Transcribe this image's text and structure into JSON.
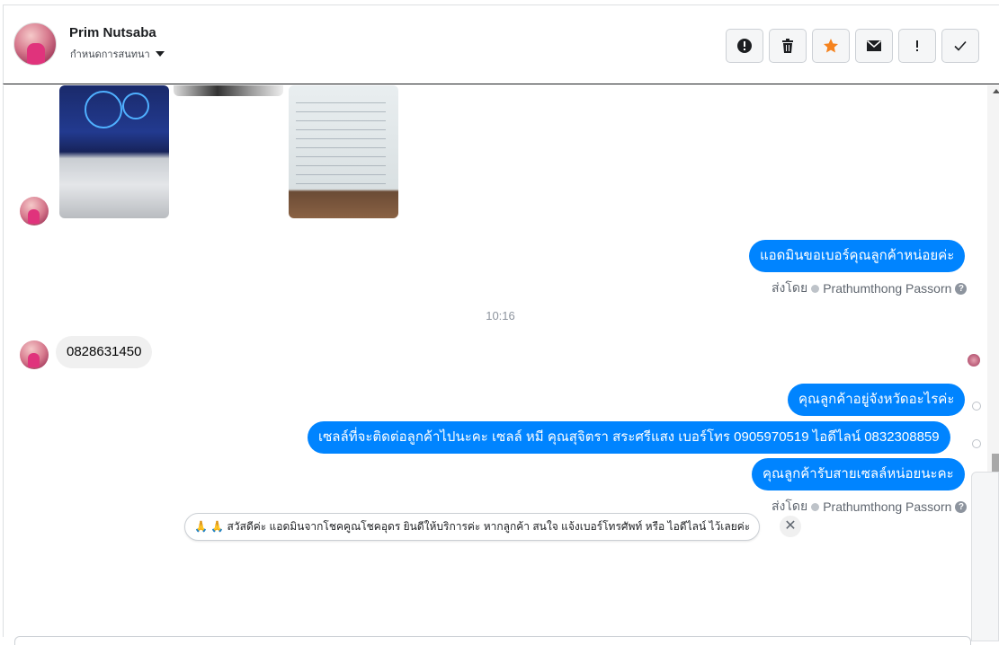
{
  "header": {
    "name": "Prim Nutsaba",
    "subtitle": "กำหนดการสนทนา",
    "actions": [
      {
        "icon": "alert-circle-icon",
        "label": "!"
      },
      {
        "icon": "trash-icon",
        "label": ""
      },
      {
        "icon": "star-icon",
        "label": ""
      },
      {
        "icon": "envelope-icon",
        "label": ""
      },
      {
        "icon": "exclamation-icon",
        "label": "!"
      },
      {
        "icon": "checkmark-icon",
        "label": ""
      }
    ],
    "star_color": "#f5831f"
  },
  "messages": {
    "out_1": "แอดมินขอเบอร์คุณลูกค้าหน่อยค่ะ",
    "sent_by_label_1": "ส่งโดย",
    "sent_by_name_1": "Prathumthong Passorn",
    "timestamp": "10:16",
    "in_1": "0828631450",
    "out_2": "คุณลูกค้าอยู่จังหวัดอะไรค่ะ",
    "out_3": "เซลล์ที่จะติดต่อลูกค้าไปนะคะ เซลล์ หมี คุณสุจิตรา สระศรีแสง เบอร์โทร 0905970519 ไอดีไลน์ 0832308859",
    "out_4": "คุณลูกค้ารับสายเซลล์หน่อยนะคะ",
    "sent_by_label_2": "ส่งโดย",
    "sent_by_name_2": "Prathumthong Passorn"
  },
  "suggestion": {
    "text": "🙏 🙏 สวัสดีค่ะ แอดมินจากโชคคูณโชคอุดร ยินดีให้บริการค่ะ หากลูกค้า สนใจ แจ้งเบอร์โทรศัพท์ หรือ ไอดีไลน์ ไว้เลยค่ะ",
    "close": "✕"
  },
  "colors": {
    "outgoing_bubble": "#0084ff",
    "incoming_bubble": "#f0f0f0"
  }
}
